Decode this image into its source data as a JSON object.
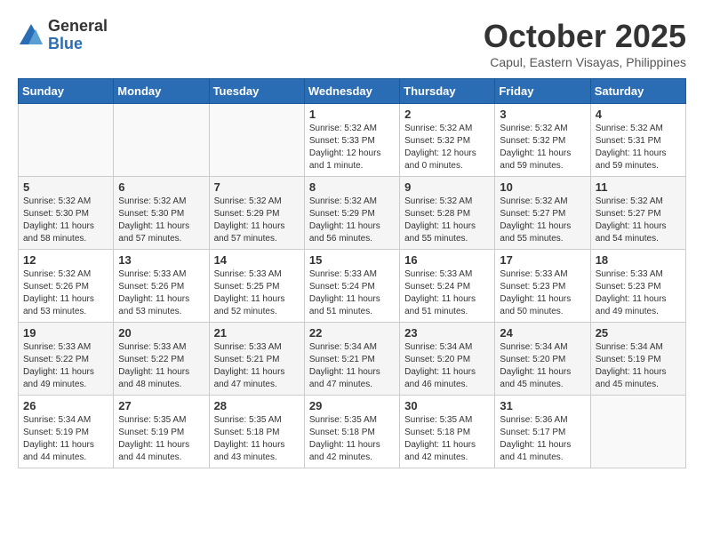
{
  "logo": {
    "general": "General",
    "blue": "Blue"
  },
  "title": "October 2025",
  "location": "Capul, Eastern Visayas, Philippines",
  "days_of_week": [
    "Sunday",
    "Monday",
    "Tuesday",
    "Wednesday",
    "Thursday",
    "Friday",
    "Saturday"
  ],
  "weeks": [
    [
      {
        "day": "",
        "info": ""
      },
      {
        "day": "",
        "info": ""
      },
      {
        "day": "",
        "info": ""
      },
      {
        "day": "1",
        "info": "Sunrise: 5:32 AM\nSunset: 5:33 PM\nDaylight: 12 hours\nand 1 minute."
      },
      {
        "day": "2",
        "info": "Sunrise: 5:32 AM\nSunset: 5:32 PM\nDaylight: 12 hours\nand 0 minutes."
      },
      {
        "day": "3",
        "info": "Sunrise: 5:32 AM\nSunset: 5:32 PM\nDaylight: 11 hours\nand 59 minutes."
      },
      {
        "day": "4",
        "info": "Sunrise: 5:32 AM\nSunset: 5:31 PM\nDaylight: 11 hours\nand 59 minutes."
      }
    ],
    [
      {
        "day": "5",
        "info": "Sunrise: 5:32 AM\nSunset: 5:30 PM\nDaylight: 11 hours\nand 58 minutes."
      },
      {
        "day": "6",
        "info": "Sunrise: 5:32 AM\nSunset: 5:30 PM\nDaylight: 11 hours\nand 57 minutes."
      },
      {
        "day": "7",
        "info": "Sunrise: 5:32 AM\nSunset: 5:29 PM\nDaylight: 11 hours\nand 57 minutes."
      },
      {
        "day": "8",
        "info": "Sunrise: 5:32 AM\nSunset: 5:29 PM\nDaylight: 11 hours\nand 56 minutes."
      },
      {
        "day": "9",
        "info": "Sunrise: 5:32 AM\nSunset: 5:28 PM\nDaylight: 11 hours\nand 55 minutes."
      },
      {
        "day": "10",
        "info": "Sunrise: 5:32 AM\nSunset: 5:27 PM\nDaylight: 11 hours\nand 55 minutes."
      },
      {
        "day": "11",
        "info": "Sunrise: 5:32 AM\nSunset: 5:27 PM\nDaylight: 11 hours\nand 54 minutes."
      }
    ],
    [
      {
        "day": "12",
        "info": "Sunrise: 5:32 AM\nSunset: 5:26 PM\nDaylight: 11 hours\nand 53 minutes."
      },
      {
        "day": "13",
        "info": "Sunrise: 5:33 AM\nSunset: 5:26 PM\nDaylight: 11 hours\nand 53 minutes."
      },
      {
        "day": "14",
        "info": "Sunrise: 5:33 AM\nSunset: 5:25 PM\nDaylight: 11 hours\nand 52 minutes."
      },
      {
        "day": "15",
        "info": "Sunrise: 5:33 AM\nSunset: 5:24 PM\nDaylight: 11 hours\nand 51 minutes."
      },
      {
        "day": "16",
        "info": "Sunrise: 5:33 AM\nSunset: 5:24 PM\nDaylight: 11 hours\nand 51 minutes."
      },
      {
        "day": "17",
        "info": "Sunrise: 5:33 AM\nSunset: 5:23 PM\nDaylight: 11 hours\nand 50 minutes."
      },
      {
        "day": "18",
        "info": "Sunrise: 5:33 AM\nSunset: 5:23 PM\nDaylight: 11 hours\nand 49 minutes."
      }
    ],
    [
      {
        "day": "19",
        "info": "Sunrise: 5:33 AM\nSunset: 5:22 PM\nDaylight: 11 hours\nand 49 minutes."
      },
      {
        "day": "20",
        "info": "Sunrise: 5:33 AM\nSunset: 5:22 PM\nDaylight: 11 hours\nand 48 minutes."
      },
      {
        "day": "21",
        "info": "Sunrise: 5:33 AM\nSunset: 5:21 PM\nDaylight: 11 hours\nand 47 minutes."
      },
      {
        "day": "22",
        "info": "Sunrise: 5:34 AM\nSunset: 5:21 PM\nDaylight: 11 hours\nand 47 minutes."
      },
      {
        "day": "23",
        "info": "Sunrise: 5:34 AM\nSunset: 5:20 PM\nDaylight: 11 hours\nand 46 minutes."
      },
      {
        "day": "24",
        "info": "Sunrise: 5:34 AM\nSunset: 5:20 PM\nDaylight: 11 hours\nand 45 minutes."
      },
      {
        "day": "25",
        "info": "Sunrise: 5:34 AM\nSunset: 5:19 PM\nDaylight: 11 hours\nand 45 minutes."
      }
    ],
    [
      {
        "day": "26",
        "info": "Sunrise: 5:34 AM\nSunset: 5:19 PM\nDaylight: 11 hours\nand 44 minutes."
      },
      {
        "day": "27",
        "info": "Sunrise: 5:35 AM\nSunset: 5:19 PM\nDaylight: 11 hours\nand 44 minutes."
      },
      {
        "day": "28",
        "info": "Sunrise: 5:35 AM\nSunset: 5:18 PM\nDaylight: 11 hours\nand 43 minutes."
      },
      {
        "day": "29",
        "info": "Sunrise: 5:35 AM\nSunset: 5:18 PM\nDaylight: 11 hours\nand 42 minutes."
      },
      {
        "day": "30",
        "info": "Sunrise: 5:35 AM\nSunset: 5:18 PM\nDaylight: 11 hours\nand 42 minutes."
      },
      {
        "day": "31",
        "info": "Sunrise: 5:36 AM\nSunset: 5:17 PM\nDaylight: 11 hours\nand 41 minutes."
      },
      {
        "day": "",
        "info": ""
      }
    ]
  ]
}
